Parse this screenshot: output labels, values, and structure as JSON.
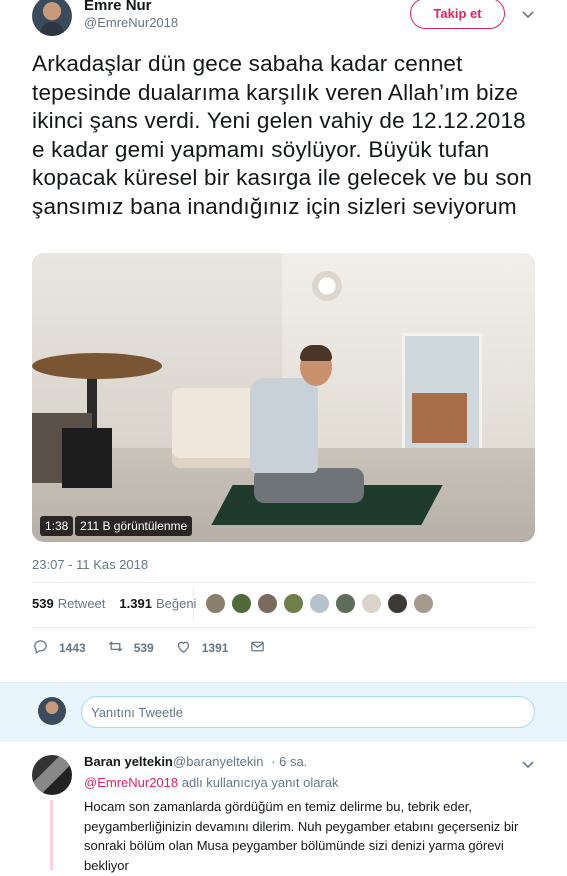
{
  "author": {
    "name": "Emre Nur",
    "handle": "@EmreNur2018",
    "follow_label": "Takip et"
  },
  "tweet": {
    "text": "Arkadaşlar dün gece sabaha kadar cennet tepesinde dualarıma karşılık veren Allah’ım bize ikinci şans verdi. Yeni gelen vahiy de 12.12.2018 e kadar gemi yapmamı söylüyor. Büyük tufan kopacak küresel bir kasırga ile gelecek ve bu son şansımız bana inandığınız için sizleri seviyorum",
    "video_duration": "1:38",
    "video_views": "211 B görüntülenme",
    "timestamp": "23:07 - 11 Kas 2018",
    "retweet_count": "539",
    "retweet_label": "Retweet",
    "like_count": "1.391",
    "like_label": "Beğeni"
  },
  "actions": {
    "reply_count": "1443",
    "retweet_count": "539",
    "like_count": "1391"
  },
  "reply_box": {
    "placeholder": "Yanıtını Tweetle"
  },
  "reply": {
    "name": "Baran yeltekin",
    "handle": "@baranyeltekin",
    "time": "· 6 sa.",
    "reply_to_user": "@EmreNur2018",
    "reply_to_suffix": " adlı kullanıcıya yanıt olarak",
    "text": "Hocam son zamanlarda gördüğüm en temiz delirme bu, tebrik eder, peygamberliğinizin devamını dilerim. Nuh peygamber etabını geçerseniz bir sonraki bölüm olan Musa peygamber bölümünde sizi denizi yarma görevi bekliyor"
  },
  "colors": {
    "accent": "#e0245e",
    "muted": "#657786",
    "text": "#14171a",
    "reply_bg": "#e8f5fd"
  },
  "icons": {
    "caret": "chevron-down-icon",
    "reply": "reply-icon",
    "retweet": "retweet-icon",
    "like": "heart-icon",
    "dm": "envelope-icon"
  }
}
